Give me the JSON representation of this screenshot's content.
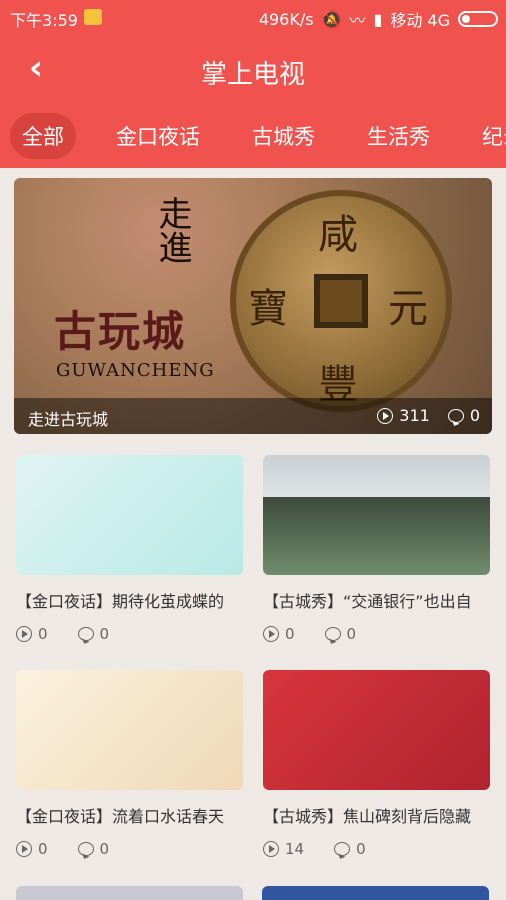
{
  "status_bar": {
    "time": "下午3:59",
    "network_speed": "496K/s",
    "carrier": "移动 4G"
  },
  "header": {
    "back_icon": "chevron-left-icon",
    "title": "掌上电视"
  },
  "tabs": [
    {
      "label": "全部",
      "active": true
    },
    {
      "label": "金口夜话",
      "active": false
    },
    {
      "label": "古城秀",
      "active": false
    },
    {
      "label": "生活秀",
      "active": false
    },
    {
      "label": "纪录",
      "active": false
    }
  ],
  "banner": {
    "vertical_text": "走進",
    "main_text": "古玩城",
    "english_text": "GUWANCHENG",
    "coin_chars": [
      "咸",
      "豐",
      "元",
      "寶"
    ],
    "caption": "走进古玩城",
    "plays": "311",
    "comments": "0"
  },
  "cards": [
    {
      "title": "【金口夜话】期待化茧成蝶的",
      "plays": "0",
      "comments": "0"
    },
    {
      "title": "【古城秀】“交通银行”也出自",
      "plays": "0",
      "comments": "0"
    },
    {
      "title": "【金口夜话】流着口水话春天",
      "plays": "0",
      "comments": "0"
    },
    {
      "title": "【古城秀】焦山碑刻背后隐藏",
      "plays": "14",
      "comments": "0"
    }
  ],
  "colors": {
    "primary_red": "#f0524d",
    "active_tab": "#d8433e",
    "background": "#efe9e6"
  }
}
